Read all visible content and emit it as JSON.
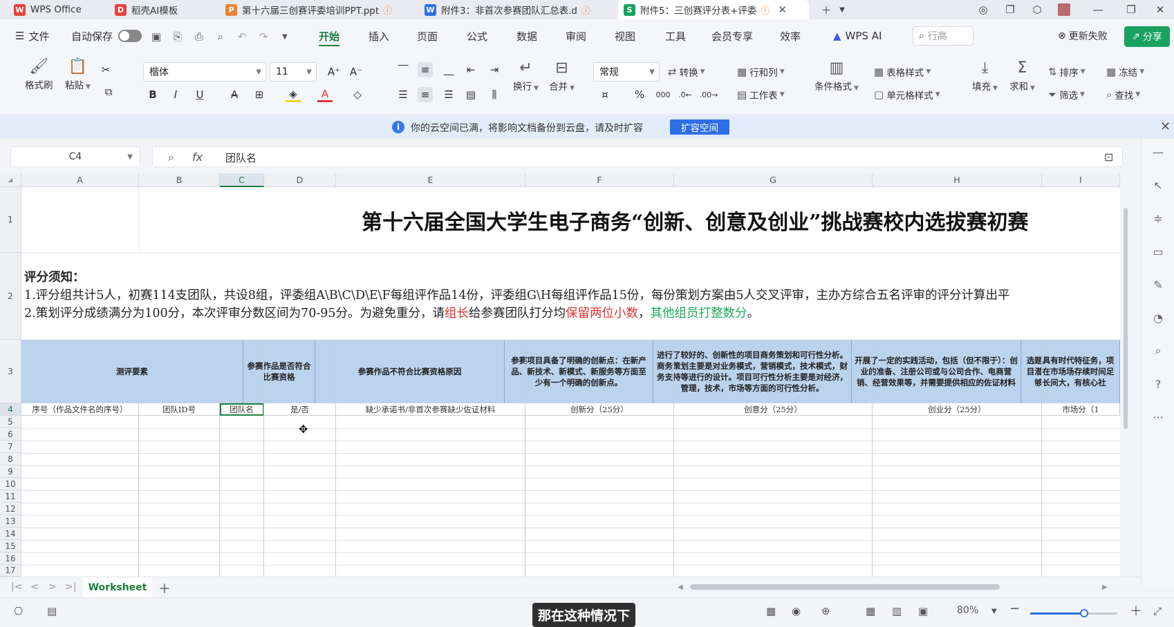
{
  "tabs": [
    {
      "label": "WPS Office",
      "icon": "wps-logo-icon",
      "color": "#e8413c",
      "warn": false
    },
    {
      "label": "稻壳AI模板",
      "icon": "docer-icon",
      "color": "#e8413c",
      "warn": false
    },
    {
      "label": "第十六届三创赛评委培训PPT.ppt",
      "icon": "ppt-file-icon",
      "color": "#e8833a",
      "warn": true
    },
    {
      "label": "附件3：非首次参赛团队汇总表.d",
      "icon": "word-file-icon",
      "color": "#2f6fe4",
      "warn": true
    },
    {
      "label": "附件5：三创赛评分表+评委",
      "icon": "sheet-file-icon",
      "color": "#1aa260",
      "warn": true
    }
  ],
  "menu": {
    "file": "文件",
    "autosave": "自动保存",
    "items": [
      "开始",
      "插入",
      "页面",
      "公式",
      "数据",
      "审阅",
      "视图",
      "工具",
      "会员专享",
      "效率"
    ],
    "active": "开始",
    "wps_ai": "WPS AI",
    "search_placeholder": "行高",
    "update_failed": "更新失败",
    "share": "分享"
  },
  "ribbon": {
    "format_painter": "格式刷",
    "paste": "粘贴",
    "font_name": "楷体",
    "font_size": "11",
    "wrap": "换行",
    "merge": "合并",
    "number_format": "常规",
    "convert": "转换",
    "rows_cols": "行和列",
    "worksheet": "工作表",
    "cond_format": "条件格式",
    "table_style": "表格样式",
    "cell_style": "单元格样式",
    "fill": "填充",
    "sum": "求和",
    "sort": "排序",
    "filter": "筛选",
    "freeze": "冻结",
    "find": "查找"
  },
  "notice": {
    "text": "你的云空间已满，将影响文档备份到云盘，请及时扩容",
    "button": "扩容空间"
  },
  "formula_bar": {
    "cell_ref": "C4",
    "content": "团队名"
  },
  "columns": [
    "A",
    "B",
    "C",
    "D",
    "E",
    "F",
    "G",
    "H",
    "I"
  ],
  "selected_column": "C",
  "rows": [
    "1",
    "2",
    "3",
    "4",
    "5",
    "6",
    "7",
    "8",
    "9",
    "10",
    "11",
    "12",
    "13",
    "14",
    "15",
    "16",
    "17"
  ],
  "sheet": {
    "title": "第十六届全国大学生电子商务“创新、创意及创业”挑战赛校内选拔赛初赛",
    "notes_heading": "评分须知：",
    "note1": "1.评分组共计5人，初赛114支团队，共设8组，评委组A\\B\\C\\D\\E\\F每组评作品14份，评委组G\\H每组评作品15份，每份策划方案由5人交叉评审，主办方综合五名评审的评分计算出平",
    "note2_a": "2.策划评分成绩满分为100分，本次评审分数区间为70-95分。为避免重分，请",
    "note2_red1": "组长",
    "note2_b": "给参赛团队打分均",
    "note2_red2": "保留两位小数",
    "note2_c": "，",
    "note2_green": "其他组员打整数分",
    "note2_d": "。",
    "header_row3": [
      "测评要素",
      "参赛作品是否符合比赛资格",
      "参赛作品不符合比赛资格原因",
      "参赛项目具备了明确的创新点：在新产品、新技术、新模式、新服务等方面至少有一个明确的创新点。",
      "进行了较好的、创新性的项目商务策划和可行性分析。商务策划主要是对业务模式，营销模式，技术模式，财务支持等进行的设计。项目可行性分析主要是对经济，管理，技术，市场等方面的可行性分析。",
      "开展了一定的实践活动，包括（但不限于）：创业的准备、注册公司或与公司合作、电商营销、经营效果等，并需要提供相应的佐证材料",
      "选题具有时代特征务，项目潜在市场场存续时间足够长间大，有核心社"
    ],
    "header_row4": [
      "序号（作品文件名的序号）",
      "团队ID号",
      "团队名",
      "是/否",
      "缺少承诺书/非首次参赛缺少佐证材料",
      "创新分（25分）",
      "创意分（25分）",
      "创业分（25分）",
      "市场分（1"
    ]
  },
  "sheet_tab": "Worksheet",
  "status": {
    "zoom": "80%",
    "zoom_level": 0.62
  },
  "subtitle": "那在这种情况下"
}
